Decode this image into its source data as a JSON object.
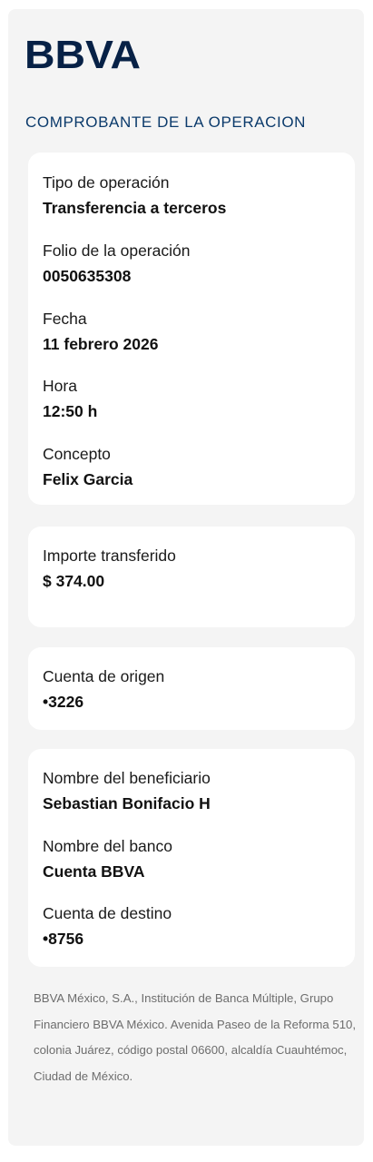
{
  "brand": {
    "logo_text": "BBVA",
    "color": "#072146"
  },
  "header": {
    "title": "COMPROBANTE DE LA OPERACION"
  },
  "operation": {
    "type_label": "Tipo de operación",
    "type_value": "Transferencia a terceros",
    "folio_label": "Folio de la operación",
    "folio_value": "0050635308",
    "date_label": "Fecha",
    "date_value": "11 febrero 2026",
    "time_label": "Hora",
    "time_value": "12:50 h",
    "concept_label": "Concepto",
    "concept_value": "Felix Garcia"
  },
  "amount": {
    "label": "Importe transferido",
    "value": "$ 374.00"
  },
  "origin": {
    "label": "Cuenta de origen",
    "value": "•3226"
  },
  "beneficiary": {
    "name_label": "Nombre del beneficiario",
    "name_value": "Sebastian Bonifacio H",
    "bank_label": "Nombre del banco",
    "bank_value": "Cuenta BBVA",
    "account_label": "Cuenta de destino",
    "account_value": "•8756"
  },
  "footer": {
    "legal_text": "BBVA México, S.A., Institución de Banca Múltiple, Grupo Financiero BBVA México. Avenida Paseo de la Reforma 510, colonia Juárez, código postal 06600, alcaldía Cuauhtémoc, Ciudad de México."
  }
}
